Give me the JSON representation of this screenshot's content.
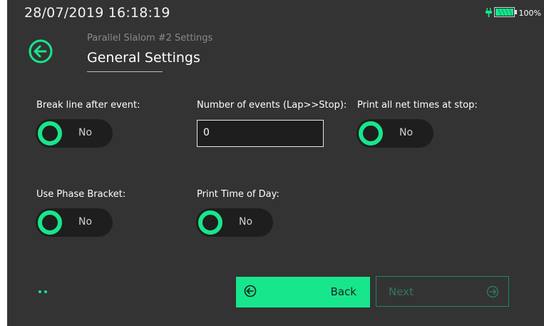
{
  "status_bar": {
    "datetime": "28/07/2019  16:18:19",
    "battery_percent": "100%",
    "battery_level": 1.0,
    "icons": [
      "plug-icon",
      "battery-icon"
    ]
  },
  "header": {
    "breadcrumb": "Parallel Slalom #2 Settings",
    "title": "General Settings",
    "back_icon": "arrow-left-circle-icon"
  },
  "settings": {
    "break_line": {
      "label": "Break line after event:",
      "value": "No"
    },
    "num_events": {
      "label": "Number of events (Lap>>Stop):",
      "value": "0"
    },
    "print_net_times": {
      "label": "Print all net times at stop:",
      "value": "No"
    },
    "phase_bracket": {
      "label": "Use Phase Bracket:",
      "value": "No"
    },
    "time_of_day": {
      "label": "Print Time of Day:",
      "value": "No"
    }
  },
  "pagination": {
    "pages": 2,
    "current": 1
  },
  "footer": {
    "back_label": "Back",
    "next_label": "Next"
  },
  "colors": {
    "accent": "#17e68c",
    "background": "#333333",
    "control": "#1e1e1e"
  }
}
